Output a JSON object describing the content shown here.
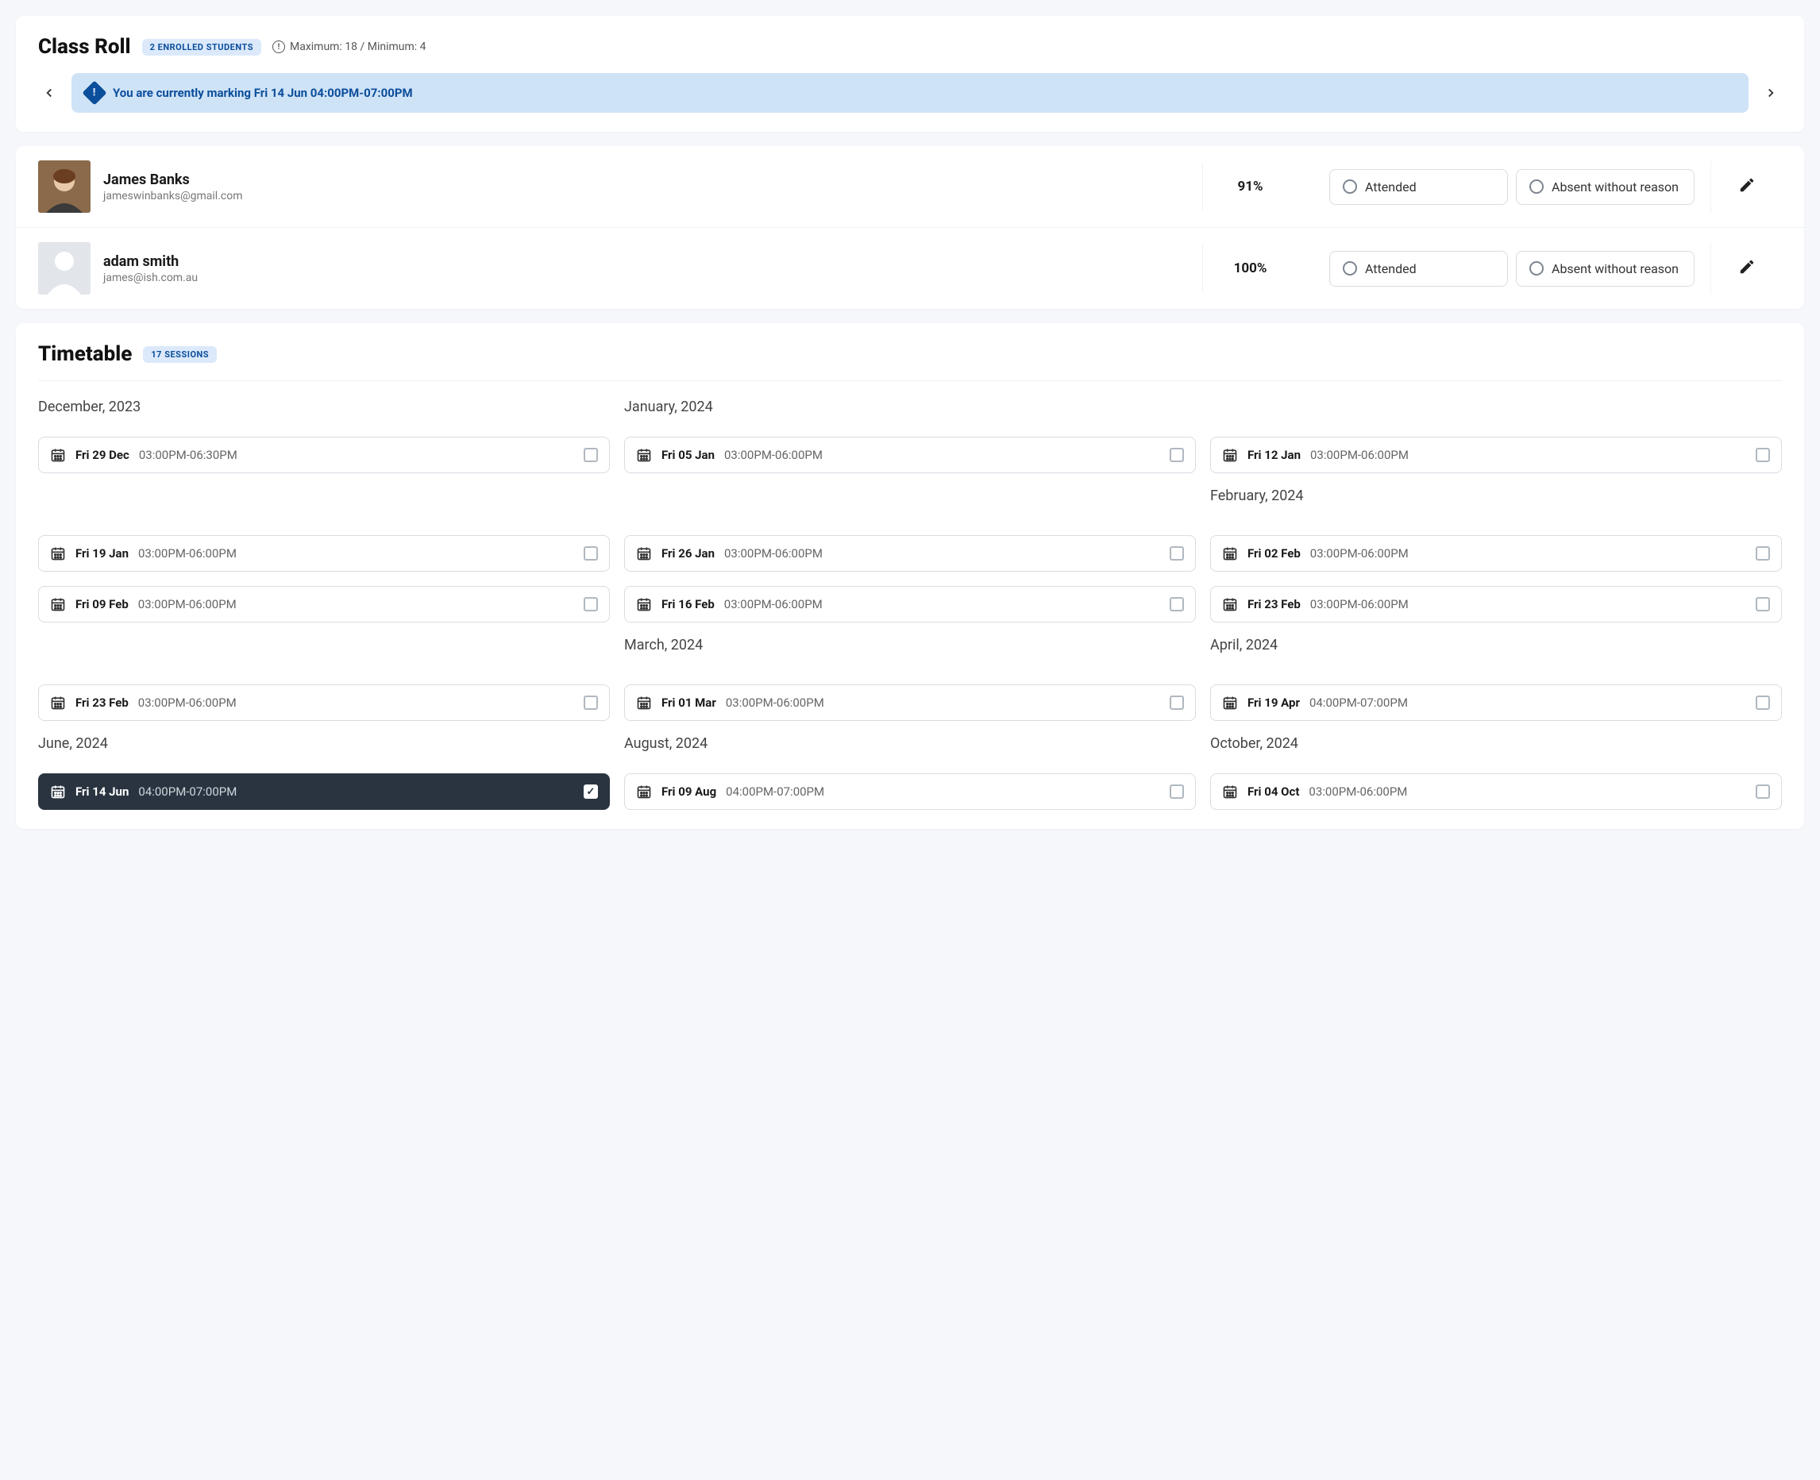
{
  "classRoll": {
    "title": "Class Roll",
    "badge": "2 ENROLLED STUDENTS",
    "meta": "Maximum: 18 / Minimum: 4",
    "banner": "You are currently marking Fri 14 Jun 04:00PM-07:00PM"
  },
  "students": [
    {
      "name": "James Banks",
      "email": "jameswinbanks@gmail.com",
      "pct": "91%",
      "hasPhoto": true
    },
    {
      "name": "adam smith",
      "email": "james@ish.com.au",
      "pct": "100%",
      "hasPhoto": false
    }
  ],
  "attOptions": {
    "attended": "Attended",
    "absent": "Absent without reason"
  },
  "timetable": {
    "title": "Timetable",
    "badge": "17 SESSIONS"
  },
  "grid": [
    [
      {
        "type": "label",
        "text": "December, 2023"
      },
      {
        "type": "label",
        "text": "January, 2024"
      },
      {
        "type": "label",
        "text": ""
      }
    ],
    [
      {
        "type": "session",
        "date": "Fri 29 Dec",
        "time": "03:00PM-06:30PM"
      },
      {
        "type": "session",
        "date": "Fri 05 Jan",
        "time": "03:00PM-06:00PM"
      },
      {
        "type": "session",
        "date": "Fri 12 Jan",
        "time": "03:00PM-06:00PM"
      }
    ],
    [
      {
        "type": "spacer"
      },
      {
        "type": "spacer"
      },
      {
        "type": "label",
        "text": "February, 2024"
      }
    ],
    [
      {
        "type": "session",
        "date": "Fri 19 Jan",
        "time": "03:00PM-06:00PM"
      },
      {
        "type": "session",
        "date": "Fri 26 Jan",
        "time": "03:00PM-06:00PM"
      },
      {
        "type": "session",
        "date": "Fri 02 Feb",
        "time": "03:00PM-06:00PM"
      }
    ],
    [
      {
        "type": "session",
        "date": "Fri 09 Feb",
        "time": "03:00PM-06:00PM"
      },
      {
        "type": "session",
        "date": "Fri 16 Feb",
        "time": "03:00PM-06:00PM"
      },
      {
        "type": "session",
        "date": "Fri 23 Feb",
        "time": "03:00PM-06:00PM"
      }
    ],
    [
      {
        "type": "spacer"
      },
      {
        "type": "label",
        "text": "March, 2024"
      },
      {
        "type": "label",
        "text": "April, 2024"
      }
    ],
    [
      {
        "type": "session",
        "date": "Fri 23 Feb",
        "time": "03:00PM-06:00PM"
      },
      {
        "type": "session",
        "date": "Fri 01 Mar",
        "time": "03:00PM-06:00PM"
      },
      {
        "type": "session",
        "date": "Fri 19 Apr",
        "time": "04:00PM-07:00PM"
      }
    ],
    [
      {
        "type": "label",
        "text": "June, 2024"
      },
      {
        "type": "label",
        "text": "August, 2024"
      },
      {
        "type": "label",
        "text": "October, 2024"
      }
    ],
    [
      {
        "type": "session",
        "date": "Fri 14 Jun",
        "time": "04:00PM-07:00PM",
        "active": true
      },
      {
        "type": "session",
        "date": "Fri 09 Aug",
        "time": "04:00PM-07:00PM"
      },
      {
        "type": "session",
        "date": "Fri 04 Oct",
        "time": "03:00PM-06:00PM"
      }
    ]
  ]
}
